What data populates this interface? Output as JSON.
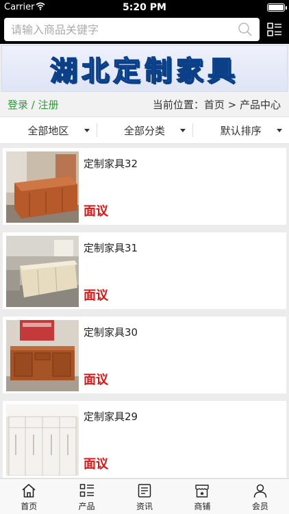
{
  "status_bar": {
    "carrier": "Carrier",
    "time": "5:20 PM"
  },
  "search": {
    "placeholder": "请输入商品关键字"
  },
  "banner": {
    "title": "湖北定制家具"
  },
  "location": {
    "login": "登录",
    "separator": " / ",
    "register": "注册",
    "prefix": "当前位置：",
    "home": "首页",
    "arrow": " > ",
    "current": "产品中心"
  },
  "filters": [
    "全部地区",
    "全部分类",
    "默认排序"
  ],
  "products": [
    {
      "name": "定制家具32",
      "price": "面议"
    },
    {
      "name": "定制家具31",
      "price": "面议"
    },
    {
      "name": "定制家具30",
      "price": "面议"
    },
    {
      "name": "定制家具29",
      "price": "面议"
    }
  ],
  "tabs": [
    {
      "label": "首页",
      "icon": "home-icon"
    },
    {
      "label": "产品",
      "icon": "products-icon"
    },
    {
      "label": "资讯",
      "icon": "news-icon"
    },
    {
      "label": "商铺",
      "icon": "shop-icon"
    },
    {
      "label": "会员",
      "icon": "member-icon"
    }
  ]
}
